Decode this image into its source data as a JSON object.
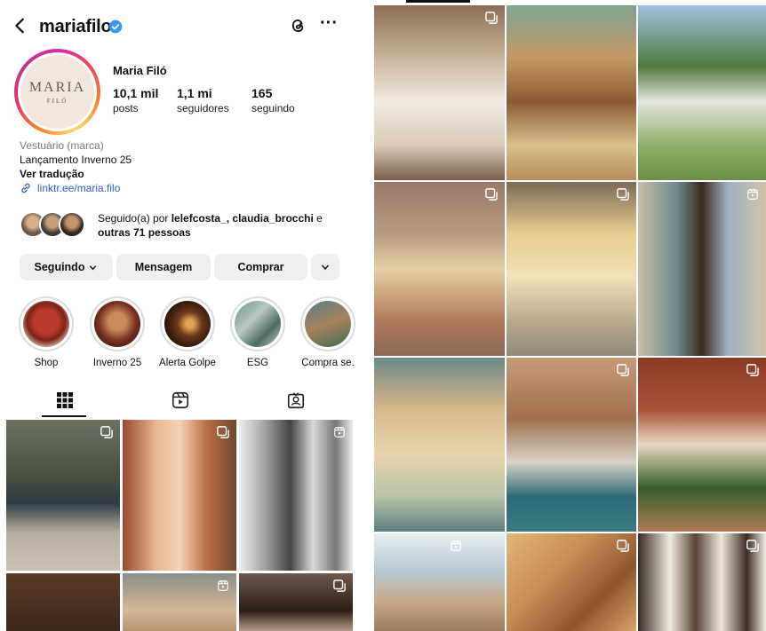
{
  "profile": {
    "username": "mariafilo",
    "display_name": "Maria Filó",
    "avatar_logo_main": "MARIA",
    "avatar_logo_sub": "FILÓ",
    "stats": [
      {
        "value": "10,1 mil",
        "label": "posts"
      },
      {
        "value": "1,1 mi",
        "label": "seguidores"
      },
      {
        "value": "165",
        "label": "seguindo"
      }
    ],
    "category": "Vestuário (marca)",
    "bio": "Lançamento Inverno 25",
    "translate": "Ver tradução",
    "link": "linktr.ee/maria.filo",
    "followed_by": {
      "prefix": "Seguido(a) por ",
      "names": "lelefcosta_, claudia_brocchi",
      "connector": " e",
      "others": "outras 71 pessoas"
    }
  },
  "buttons": {
    "following": "Seguindo",
    "message": "Mensagem",
    "shop": "Comprar"
  },
  "highlights": [
    {
      "label": "Shop",
      "icon": "highlight-shop"
    },
    {
      "label": "Inverno 25",
      "icon": "highlight-inverno"
    },
    {
      "label": "Alerta Golpe",
      "icon": "highlight-alerta"
    },
    {
      "label": "ESG",
      "icon": "highlight-esg"
    },
    {
      "label": "Compra se.",
      "icon": "highlight-compra"
    }
  ],
  "tabs": [
    {
      "name": "posts-grid",
      "icon": "grid-icon"
    },
    {
      "name": "reels",
      "icon": "reels-icon"
    },
    {
      "name": "tagged",
      "icon": "tagged-icon"
    }
  ],
  "colors": {
    "link": "#2b5fd1",
    "verified": "#3897f0",
    "button_bg": "#efefef"
  }
}
